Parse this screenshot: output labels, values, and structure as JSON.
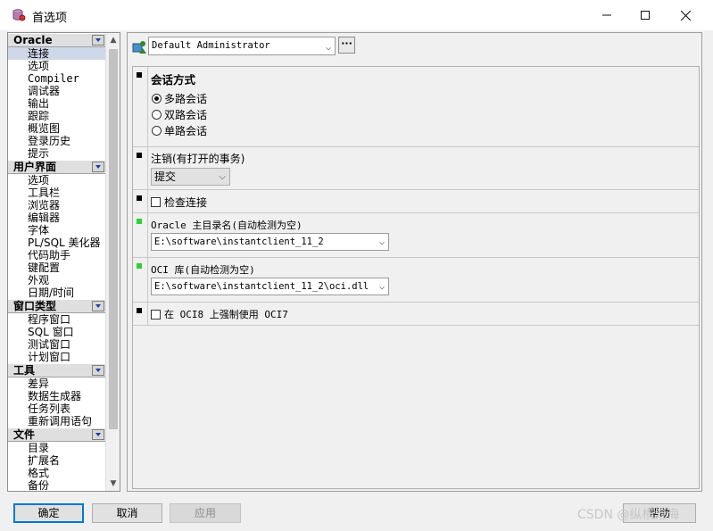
{
  "window": {
    "title": "首选项",
    "icon": "database-icon"
  },
  "nav": {
    "categories": [
      {
        "label": "Oracle",
        "items": [
          "连接",
          "选项",
          "Compiler",
          "调试器",
          "输出",
          "跟踪",
          "概览图",
          "登录历史",
          "提示"
        ]
      },
      {
        "label": "用户界面",
        "items": [
          "选项",
          "工具栏",
          "浏览器",
          "编辑器",
          "字体",
          "PL/SQL 美化器",
          "代码助手",
          "键配置",
          "外观",
          "日期/时间"
        ]
      },
      {
        "label": "窗口类型",
        "items": [
          "程序窗口",
          "SQL 窗口",
          "测试窗口",
          "计划窗口"
        ]
      },
      {
        "label": "工具",
        "items": [
          "差异",
          "数据生成器",
          "任务列表",
          "重新调用语句"
        ]
      },
      {
        "label": "文件",
        "items": [
          "目录",
          "扩展名",
          "格式",
          "备份"
        ]
      }
    ],
    "selected": "连接"
  },
  "profile": {
    "value": "Default Administrator",
    "more_label": "···"
  },
  "session_mode": {
    "title": "会话方式",
    "options": [
      "多路会话",
      "双路会话",
      "单路会话"
    ],
    "selected_index": 0
  },
  "logoff": {
    "label": "注销(有打开的事务)",
    "value": "提交"
  },
  "check_connection": {
    "label": "检查连接",
    "checked": false
  },
  "oracle_home": {
    "label": "Oracle 主目录名(自动检测为空)",
    "value": "E:\\software\\instantclient_11_2"
  },
  "oci_library": {
    "label": "OCI 库(自动检测为空)",
    "value": "E:\\software\\instantclient_11_2\\oci.dll"
  },
  "force_oci7": {
    "label": "在 OCI8 上强制使用 OCI7",
    "checked": false
  },
  "buttons": {
    "ok": "确定",
    "cancel": "取消",
    "apply": "应用",
    "help": "帮助"
  },
  "watermark": "CSDN @纵横沧海",
  "colors": {
    "accent": "#0078d7",
    "changed_marker": "#2ed12e",
    "default_marker": "#000000"
  }
}
